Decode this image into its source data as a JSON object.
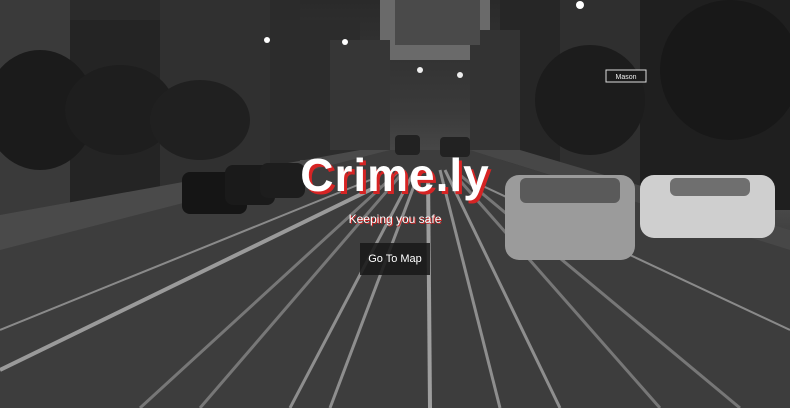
{
  "hero": {
    "title": "Crime.ly",
    "tagline": "Keeping you safe",
    "cta_label": "Go To Map",
    "accent_color": "#d62424"
  },
  "street_sign": {
    "text": "Mason"
  }
}
